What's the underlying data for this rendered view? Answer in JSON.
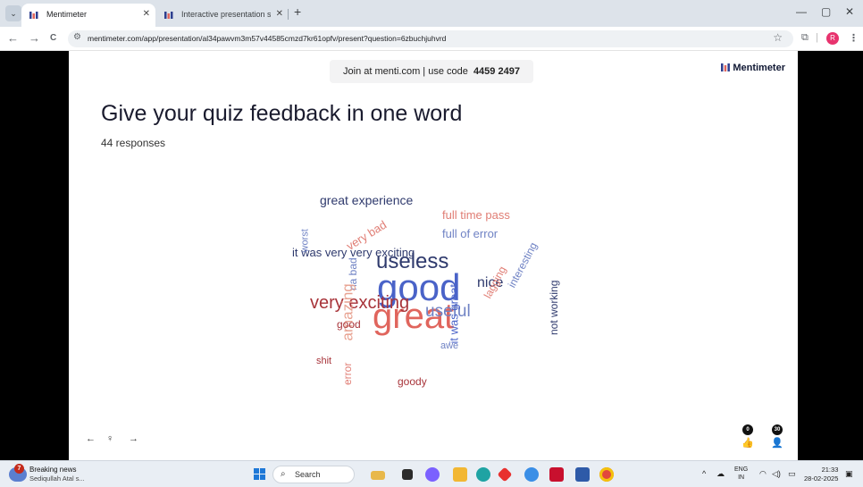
{
  "browser": {
    "tabs": [
      {
        "title": "Mentimeter",
        "active": true
      },
      {
        "title": "Interactive presentation softwa",
        "active": false
      }
    ],
    "url": "mentimeter.com/app/presentation/al34pawvm3m57v44585cmzd7kr61opfv/present?question=6zbuchjuhvrd",
    "icons": {
      "back": "←",
      "forward": "→",
      "reload": "C",
      "star": "☆",
      "new_tab": "+",
      "minimize": "—",
      "restore": "▢",
      "close": "✕",
      "profile": "R",
      "menu": "⋮",
      "extensions": "⧉"
    }
  },
  "presentation": {
    "join_text": "Join at menti.com | use code",
    "join_code": "4459 2497",
    "brand": "Mentimeter",
    "question": "Give your quiz feedback in one word",
    "responses": "44 responses",
    "controls": {
      "prev": "←",
      "hint": "♀",
      "next": "→"
    },
    "reactions": [
      {
        "count": "0",
        "icon": "thumbs-up-icon"
      },
      {
        "count": "30",
        "icon": "person-icon"
      }
    ],
    "word_cloud": [
      {
        "text": "great experience",
        "size": 14,
        "color": "#2f3a6d"
      },
      {
        "text": "full time pass",
        "size": 13,
        "color": "#e07d74"
      },
      {
        "text": "full of error",
        "size": 13,
        "color": "#6f82c4"
      },
      {
        "text": "it was very very exciting",
        "size": 13,
        "color": "#2f3a6d"
      },
      {
        "text": "useless",
        "size": 24,
        "color": "#2f3a6d"
      },
      {
        "text": "very bad",
        "size": 13,
        "color": "#e07d74"
      },
      {
        "text": "good",
        "size": 42,
        "color": "#4a63c8"
      },
      {
        "text": "nice",
        "size": 16,
        "color": "#2f3a6d"
      },
      {
        "text": "great",
        "size": 40,
        "color": "#e0655d"
      },
      {
        "text": "useful",
        "size": 19,
        "color": "#6f82c4"
      },
      {
        "text": "very exciting",
        "size": 20,
        "color": "#a8343a"
      },
      {
        "text": "na bad",
        "size": 12,
        "color": "#6f82c4"
      },
      {
        "text": "amazing",
        "size": 17,
        "color": "#e8a392"
      },
      {
        "text": "lagging",
        "size": 12,
        "color": "#e07d74"
      },
      {
        "text": "interesting",
        "size": 12,
        "color": "#6f82c4"
      },
      {
        "text": "not working",
        "size": 12,
        "color": "#2f3a6d"
      },
      {
        "text": "shit",
        "size": 11,
        "color": "#a8343a"
      },
      {
        "text": "error",
        "size": 12,
        "color": "#e07d74"
      },
      {
        "text": "goody",
        "size": 12,
        "color": "#a8343a"
      },
      {
        "text": "it was great",
        "size": 13,
        "color": "#4a63c8"
      },
      {
        "text": "worst",
        "size": 11,
        "color": "#6f82c4"
      },
      {
        "text": "awe",
        "size": 11,
        "color": "#6f82c4"
      },
      {
        "text": "good",
        "size": 12,
        "color": "#a8343a"
      }
    ]
  },
  "taskbar": {
    "news_title": "Breaking news",
    "news_sub": "Sediqullah Atal s...",
    "news_badge": "7",
    "search_placeholder": "Search",
    "apps": [
      "file-explorer-icon",
      "notes-icon",
      "colorful-app-icon",
      "folder-icon",
      "edge-icon",
      "red-app-icon",
      "paint-icon",
      "mcafee-icon",
      "store-icon",
      "chrome-icon"
    ],
    "lang_top": "ENG",
    "lang_bottom": "IN",
    "time": "21:33",
    "date": "28-02-2025"
  },
  "colors": {
    "accent_navy": "#2f3a6d",
    "accent_blue": "#4a63c8",
    "accent_red": "#e0655d",
    "chrome_bg": "#dde3ea"
  }
}
